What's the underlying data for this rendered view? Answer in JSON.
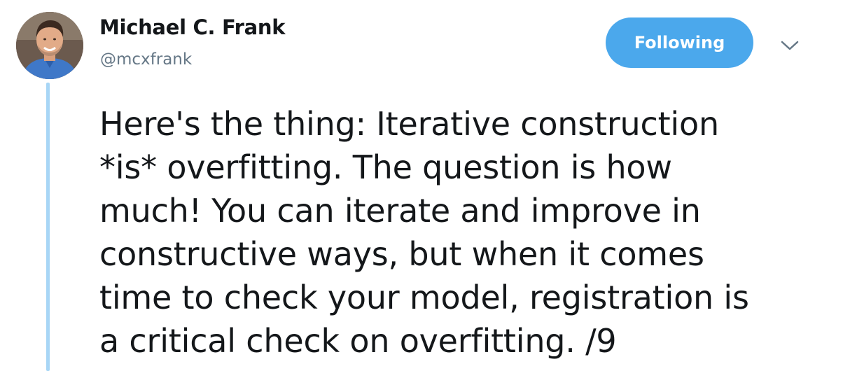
{
  "author": {
    "name": "Michael C. Frank",
    "handle": "@mcxfrank",
    "avatar_icon": "profile-photo"
  },
  "follow_button": {
    "label": "Following",
    "color": "#4ba8ec"
  },
  "more_button": {
    "icon": "chevron-down-icon"
  },
  "tweet": {
    "lines": [
      "Here's the thing: Iterative construction",
      "*is* overfitting. The question is how",
      "much! You can iterate and improve in",
      "constructive ways, but when it comes",
      "time to check your model, registration is",
      "a critical check on overfitting. /9"
    ]
  },
  "colors": {
    "thread_line": "#a8d6f6",
    "text": "#14171a",
    "handle": "#657786"
  }
}
